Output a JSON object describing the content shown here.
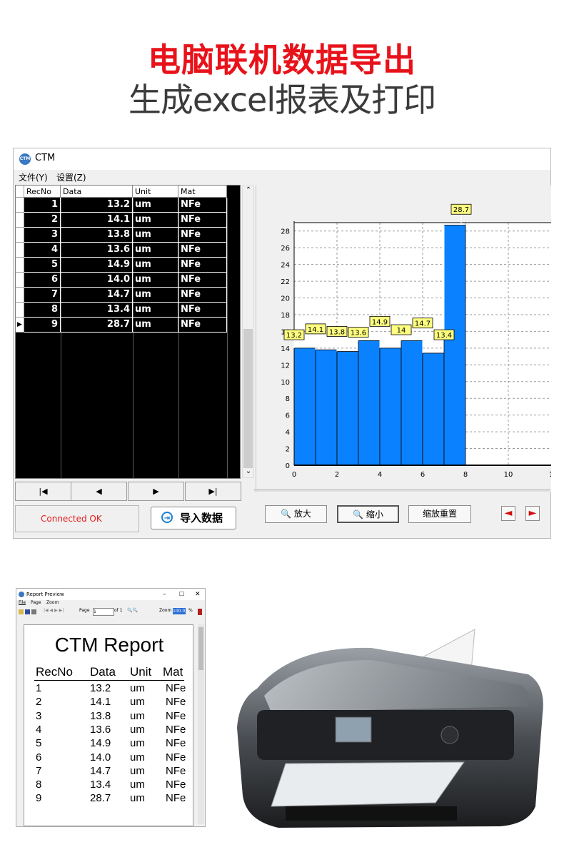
{
  "headline": {
    "line1": "电脑联机数据导出",
    "line2": "生成excel报表及打印"
  },
  "window": {
    "title": "CTM",
    "app_icon_text": "CTM",
    "menu": [
      "文件(Y)",
      "设置(Z)"
    ]
  },
  "grid": {
    "columns": [
      "RecNo",
      "Data",
      "Unit",
      "Mat"
    ],
    "rows": [
      [
        "1",
        "13.2",
        "um",
        "NFe"
      ],
      [
        "2",
        "14.1",
        "um",
        "NFe"
      ],
      [
        "3",
        "13.8",
        "um",
        "NFe"
      ],
      [
        "4",
        "13.6",
        "um",
        "NFe"
      ],
      [
        "5",
        "14.9",
        "um",
        "NFe"
      ],
      [
        "6",
        "14.0",
        "um",
        "NFe"
      ],
      [
        "7",
        "14.7",
        "um",
        "NFe"
      ],
      [
        "8",
        "13.4",
        "um",
        "NFe"
      ],
      [
        "9",
        "28.7",
        "um",
        "NFe"
      ]
    ],
    "current_row_marker": "▶",
    "selected_row": 9
  },
  "nav_buttons": [
    "|◀",
    "◀",
    "▶",
    "▶|"
  ],
  "status": {
    "text": "Connected OK",
    "color": "#e41e1e"
  },
  "import_button": {
    "label": "导入数据",
    "icon": "import-icon"
  },
  "chart_buttons": {
    "zoom_in": "放大",
    "zoom_out": "缩小",
    "reset": "缩放重置",
    "prev": "prev-arrow-icon",
    "next": "next-arrow-icon"
  },
  "chart_data": {
    "type": "bar",
    "x_ticks": [
      "0",
      "2",
      "4",
      "6",
      "8",
      "10",
      "1"
    ],
    "y_ticks": [
      "0",
      "2",
      "4",
      "6",
      "8",
      "10",
      "12",
      "14",
      "16",
      "18",
      "20",
      "22",
      "24",
      "26",
      "28"
    ],
    "ylim": [
      0,
      29
    ],
    "xlim": [
      0,
      12
    ],
    "x": [
      0,
      1,
      2,
      3,
      4,
      5,
      6,
      7
    ],
    "values": [
      14.0,
      13.8,
      13.6,
      14.9,
      14.0,
      14.9,
      13.4,
      28.7
    ],
    "data_labels": [
      "13.2",
      "14.1",
      "13.8",
      "13.6",
      "14.9",
      "14",
      "14.7",
      "13.4",
      "28.7"
    ],
    "bar_color": "#0a82ff",
    "label_bg": "#ffff80",
    "grid": true
  },
  "report_preview": {
    "window_title": "Report Preview",
    "menu": [
      "File",
      "Page",
      "Zoom"
    ],
    "page_label": "Page",
    "page_value": "1",
    "of_label": "of 1",
    "zoom_label": "Zoom",
    "zoom_value": "100.0",
    "zoom_unit": "%",
    "title": "CTM Report",
    "columns": [
      "RecNo",
      "Data",
      "Unit",
      "Mat"
    ],
    "rows": [
      [
        "1",
        "13.2",
        "um",
        "NFe"
      ],
      [
        "2",
        "14.1",
        "um",
        "NFe"
      ],
      [
        "3",
        "13.8",
        "um",
        "NFe"
      ],
      [
        "4",
        "13.6",
        "um",
        "NFe"
      ],
      [
        "5",
        "14.9",
        "um",
        "NFe"
      ],
      [
        "6",
        "14.0",
        "um",
        "NFe"
      ],
      [
        "7",
        "14.7",
        "um",
        "NFe"
      ],
      [
        "8",
        "13.4",
        "um",
        "NFe"
      ],
      [
        "9",
        "28.7",
        "um",
        "NFe"
      ]
    ]
  },
  "printer": {
    "icon": "printer-image"
  }
}
